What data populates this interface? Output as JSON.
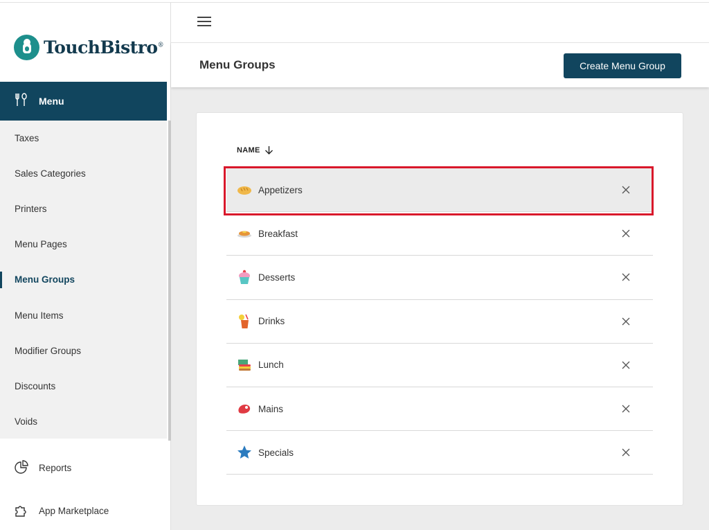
{
  "brand": {
    "name": "TouchBistro",
    "reg_mark": "®",
    "teal": "#1d8f8c",
    "navy": "#11455e"
  },
  "sidebar": {
    "section_label": "Menu",
    "items": [
      {
        "label": "Taxes",
        "active": false
      },
      {
        "label": "Sales Categories",
        "active": false
      },
      {
        "label": "Printers",
        "active": false
      },
      {
        "label": "Menu Pages",
        "active": false
      },
      {
        "label": "Menu Groups",
        "active": true
      },
      {
        "label": "Menu Items",
        "active": false
      },
      {
        "label": "Modifier Groups",
        "active": false
      },
      {
        "label": "Discounts",
        "active": false
      },
      {
        "label": "Voids",
        "active": false
      }
    ],
    "bottom": [
      {
        "label": "Reports",
        "icon": "pie-chart-icon"
      },
      {
        "label": "App Marketplace",
        "icon": "puzzle-icon"
      }
    ]
  },
  "header": {
    "title": "Menu Groups",
    "create_label": "Create Menu Group"
  },
  "table": {
    "column": "NAME",
    "sort": "descending-arrow",
    "rows": [
      {
        "name": "Appetizers",
        "icon": "bread-icon",
        "highlighted": true
      },
      {
        "name": "Breakfast",
        "icon": "pancake-icon",
        "highlighted": false
      },
      {
        "name": "Desserts",
        "icon": "cupcake-icon",
        "highlighted": false
      },
      {
        "name": "Drinks",
        "icon": "drink-icon",
        "highlighted": false
      },
      {
        "name": "Lunch",
        "icon": "sandwich-icon",
        "highlighted": false
      },
      {
        "name": "Mains",
        "icon": "steak-icon",
        "highlighted": false
      },
      {
        "name": "Specials",
        "icon": "star-icon",
        "highlighted": false
      }
    ]
  },
  "colors": {
    "highlight_border": "#d9182b",
    "row_highlight": "#ebebeb"
  }
}
